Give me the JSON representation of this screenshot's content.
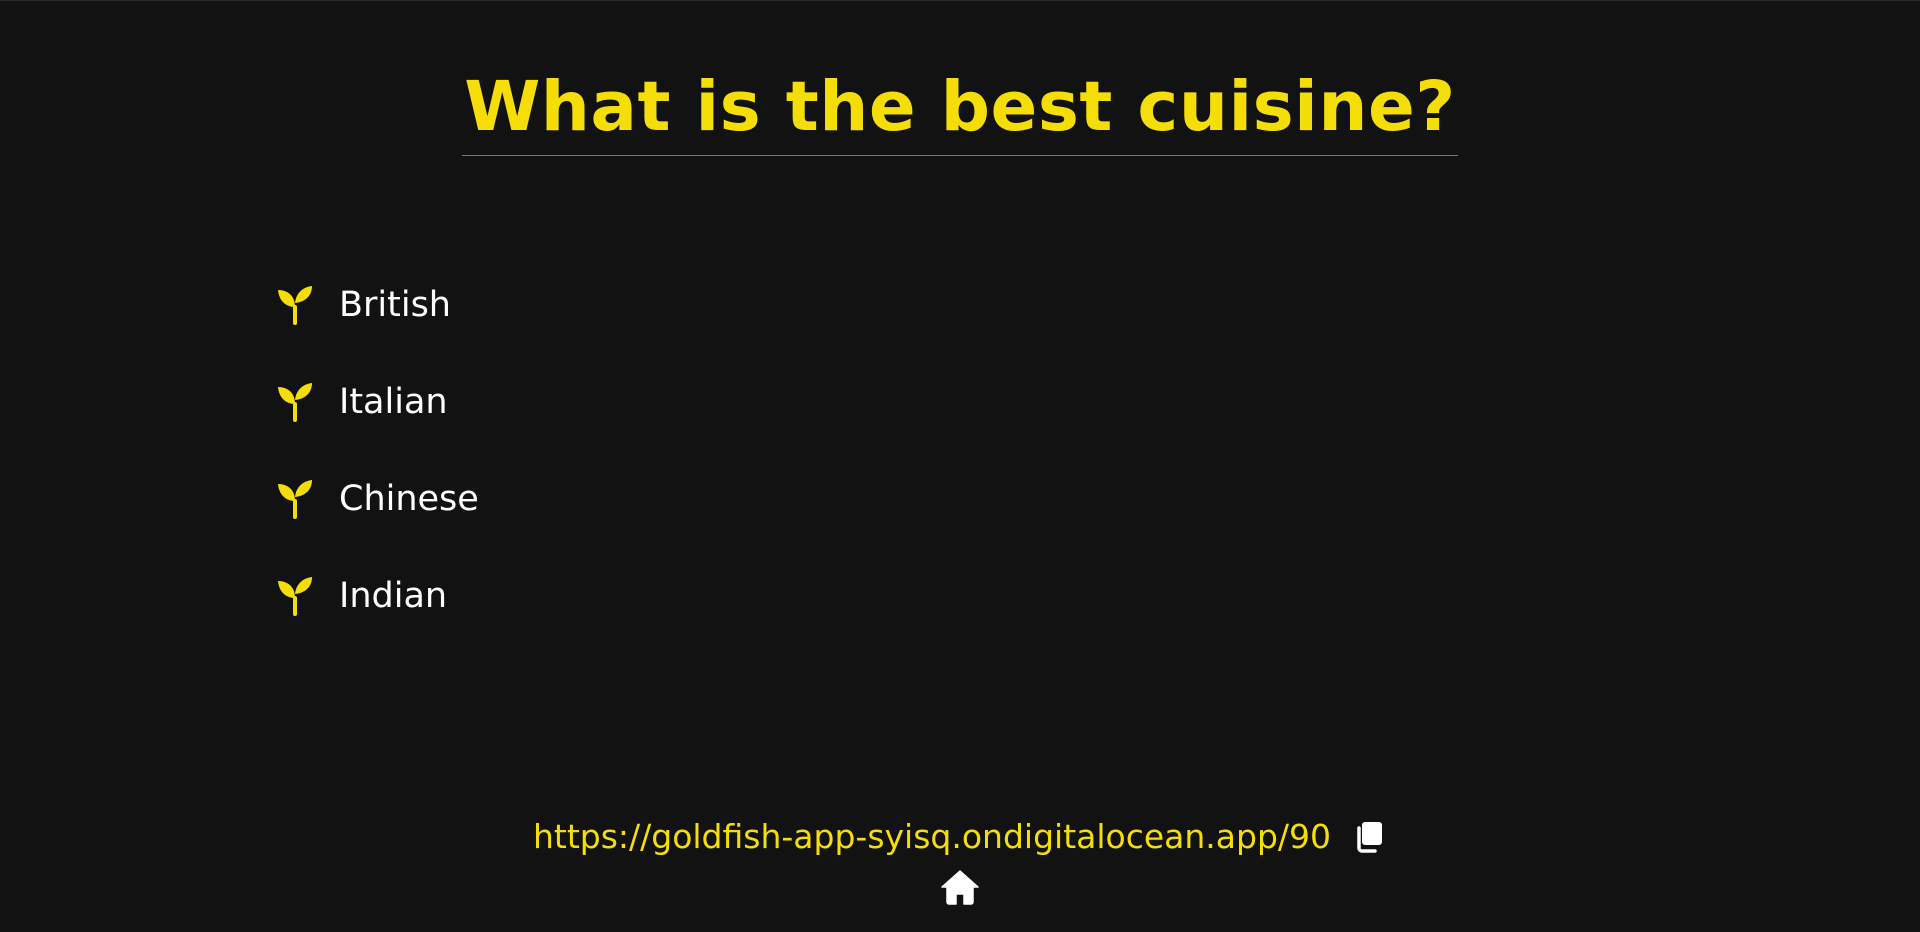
{
  "header": {
    "title": "What is the best cuisine?"
  },
  "options": [
    {
      "label": "British",
      "icon": "sprout-icon"
    },
    {
      "label": "Italian",
      "icon": "sprout-icon"
    },
    {
      "label": "Chinese",
      "icon": "sprout-icon"
    },
    {
      "label": "Indian",
      "icon": "sprout-icon"
    }
  ],
  "share": {
    "url": "https://goldfish-app-syisq.ondigitalocean.app/90",
    "copy_icon": "copy-icon"
  },
  "footer": {
    "home_icon": "home-icon"
  },
  "colors": {
    "background": "#121212",
    "accent": "#f5de07",
    "text": "#ffffff"
  }
}
